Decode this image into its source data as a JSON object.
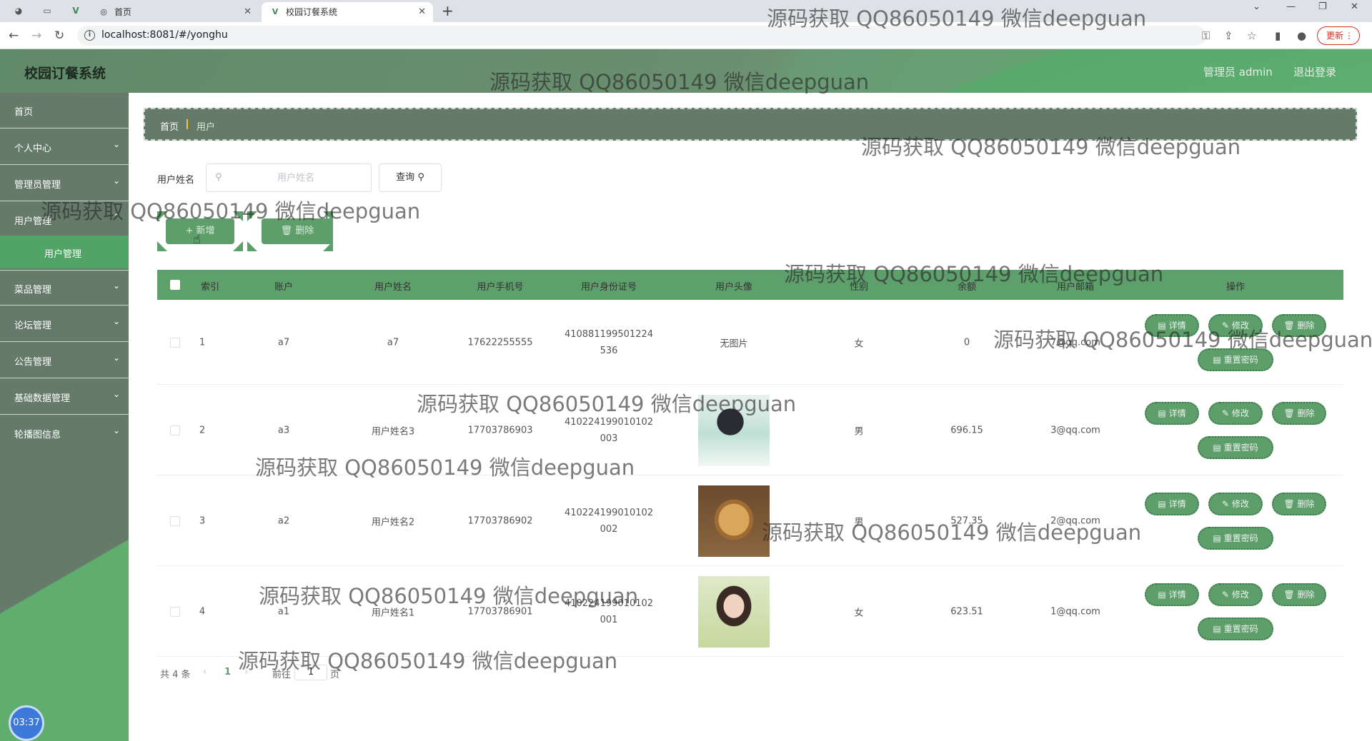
{
  "browser": {
    "tabs": [
      {
        "title": "首页",
        "icon": "globe-icon"
      },
      {
        "title": "校园订餐系统",
        "icon": "vue-icon"
      }
    ],
    "url": "localhost:8081/#/yonghu",
    "update_label": "更新"
  },
  "app": {
    "brand": "校园订餐系统",
    "header_links": [
      "管理员 admin",
      "退出登录"
    ]
  },
  "sidebar": {
    "items": [
      {
        "label": "首页",
        "has_arrow": false
      },
      {
        "label": "个人中心",
        "has_arrow": true
      },
      {
        "label": "管理员管理",
        "has_arrow": true
      },
      {
        "label": "用户管理",
        "has_arrow": true
      },
      {
        "label": "菜品管理",
        "has_arrow": true
      },
      {
        "label": "论坛管理",
        "has_arrow": true
      },
      {
        "label": "公告管理",
        "has_arrow": true
      },
      {
        "label": "基础数据管理",
        "has_arrow": true
      },
      {
        "label": "轮播图信息",
        "has_arrow": true
      }
    ],
    "sub_item": "用户管理",
    "clock": "03:37"
  },
  "breadcrumb": [
    "首页",
    "用户"
  ],
  "search": {
    "label": "用户姓名",
    "placeholder": "用户姓名",
    "query_label": "查询"
  },
  "actions": {
    "add_label": "+ 新增",
    "delete_label": "删除"
  },
  "table": {
    "headers": [
      "索引",
      "账户",
      "用户姓名",
      "用户手机号",
      "用户身份证号",
      "用户头像",
      "性别",
      "余额",
      "用户邮箱",
      "操作"
    ],
    "rows": [
      {
        "index": "1",
        "account": "a7",
        "name": "a7",
        "phone": "17622255555",
        "id_line1": "410881199501224",
        "id_line2": "536",
        "avatar": "无图片",
        "gender": "女",
        "balance": "0",
        "email": "7@qq.com"
      },
      {
        "index": "2",
        "account": "a3",
        "name": "用户姓名3",
        "phone": "17703786903",
        "id_line1": "410224199010102",
        "id_line2": "003",
        "avatar": "",
        "gender": "男",
        "balance": "696.15",
        "email": "3@qq.com"
      },
      {
        "index": "3",
        "account": "a2",
        "name": "用户姓名2",
        "phone": "17703786902",
        "id_line1": "410224199010102",
        "id_line2": "002",
        "avatar": "",
        "gender": "男",
        "balance": "527.35",
        "email": "2@qq.com"
      },
      {
        "index": "4",
        "account": "a1",
        "name": "用户姓名1",
        "phone": "17703786901",
        "id_line1": "410224199010102",
        "id_line2": "001",
        "avatar": "",
        "gender": "女",
        "balance": "623.51",
        "email": "1@qq.com"
      }
    ],
    "row_actions": {
      "detail": "详情",
      "edit": "修改",
      "delete": "删除",
      "reset": "重置密码"
    }
  },
  "pagination": {
    "total": "共 4 条",
    "current_page": "1",
    "goto_label": "前往",
    "goto_value": "1",
    "page_suffix": "页"
  },
  "watermark": "源码获取 QQ86050149 微信deepguan",
  "colors": {
    "primary": "#5e9e6b",
    "sidebar": "#657a69",
    "header_accent": "#5dae70"
  }
}
